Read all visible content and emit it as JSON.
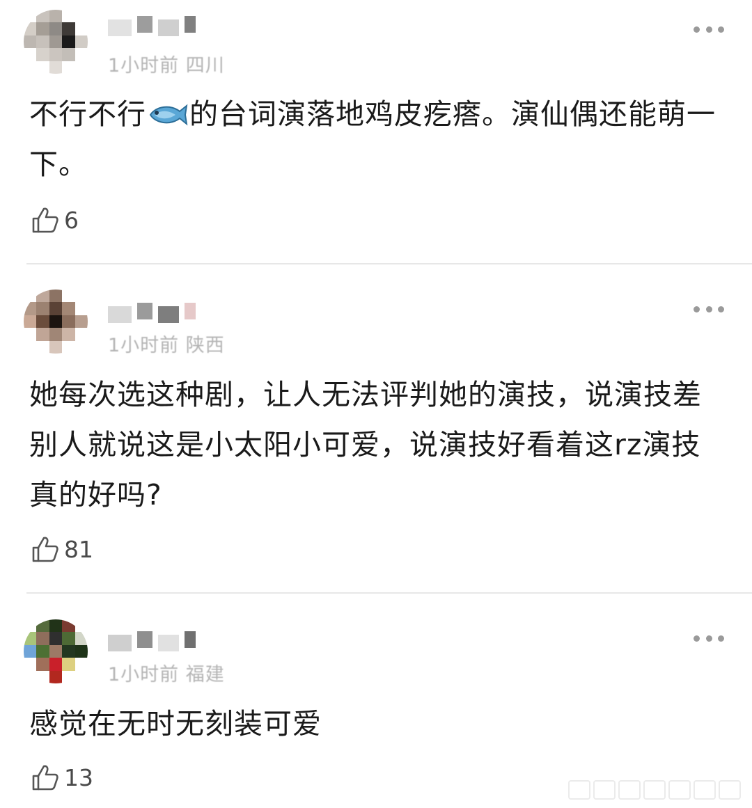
{
  "comments": [
    {
      "time": "1小时前",
      "location": "四川",
      "text": "不行不行",
      "text_after_emoji": "的台词演落地鸡皮疙瘩。演仙偶还能萌一下。",
      "emoji": "fish-emoji",
      "likes": "6",
      "avatar_colors": [
        "#ffffff",
        "#c9c3bd",
        "#b9b2ab",
        "#ffffff",
        "#ffffff",
        "#d4cec7",
        "#a59e96",
        "#8e8a86",
        "#3e3a37",
        "#ffffff",
        "#bdb7b1",
        "#c7c1bb",
        "#9f9993",
        "#1a1a1a",
        "#d1ccc6",
        "#ffffff",
        "#d7d2cc",
        "#cbc5bf",
        "#c3beb8",
        "#ffffff",
        "#ffffff",
        "#ffffff",
        "#e1dcd7",
        "#ffffff",
        "#ffffff"
      ],
      "name_colors": [
        "#e2e2e2",
        "#9d9d9d",
        "#cfcfcf",
        "#808080"
      ]
    },
    {
      "time": "1小时前",
      "location": "陕西",
      "text": "她每次选这种剧，让人无法评判她的演技，说演技差别人就说这是小太阳小可爱，说演技好看着这rz演技真的好吗?",
      "likes": "81",
      "avatar_colors": [
        "#ffffff",
        "#bfa89b",
        "#8c7364",
        "#ffffff",
        "#ffffff",
        "#b39988",
        "#9c8271",
        "#5a4236",
        "#a38775",
        "#ffffff",
        "#caa996",
        "#6b4d3c",
        "#1c1410",
        "#8a6d5c",
        "#b79e8f",
        "#ffffff",
        "#c0a596",
        "#a08676",
        "#cdb5a7",
        "#ffffff",
        "#ffffff",
        "#ffffff",
        "#d8c6bb",
        "#ffffff",
        "#ffffff"
      ],
      "name_colors": [
        "#d9d9d9",
        "#9b9b9b",
        "#7e7e7e",
        "#e6c9c9"
      ]
    },
    {
      "time": "1小时前",
      "location": "福建",
      "text": "感觉在无时无刻装可爱",
      "likes": "13",
      "avatar_colors": [
        "#ffffff",
        "#556b3c",
        "#213318",
        "#7a3b30",
        "#ffffff",
        "#a8c47a",
        "#8f6e5c",
        "#2f2f2f",
        "#4e6a35",
        "#d2d6c8",
        "#6fa4d8",
        "#4d7034",
        "#9d7a66",
        "#233720",
        "#1e3318",
        "#ffffff",
        "#a06f5a",
        "#c9202a",
        "#ddd080",
        "#ffffff",
        "#ffffff",
        "#ffffff",
        "#b2281f",
        "#ffffff",
        "#ffffff"
      ],
      "name_colors": [
        "#cfcfcf",
        "#8f8f8f",
        "#e1e1e1",
        "#707070"
      ]
    }
  ]
}
